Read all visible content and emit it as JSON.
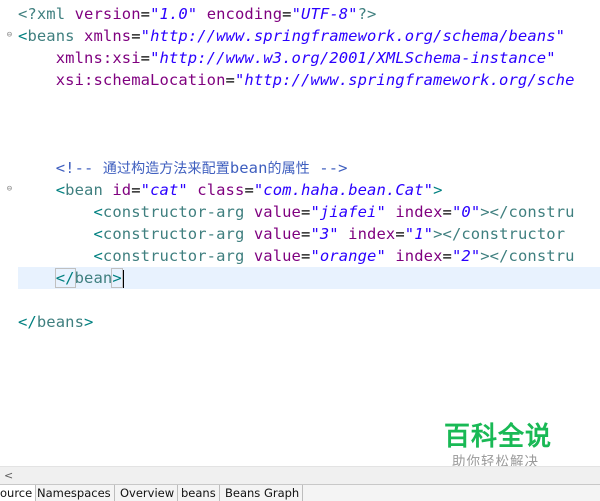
{
  "editor": {
    "line1": {
      "pi_open": "<?xml",
      "a1": "version",
      "eq": "=",
      "v1": "\"1.0\"",
      "a2": "encoding",
      "v2": "\"UTF-8\"",
      "pi_close": "?>"
    },
    "line2": {
      "open": "<",
      "tag": "beans",
      "a1": "xmlns",
      "eq": "=",
      "v1": "\"http://www.springframework.org/schema/beans\""
    },
    "line3": {
      "a1": "xmlns:xsi",
      "eq": "=",
      "v1": "\"http://www.w3.org/2001/XMLSchema-instance\""
    },
    "line4": {
      "a1": "xsi:schemaLocation",
      "eq": "=",
      "v1": "\"http://www.springframework.org/sche"
    },
    "comment": {
      "open": "<!--",
      "text_cjk": "通过构造方法来配置",
      "text_bean": "bean",
      "text_cjk2": "的属性",
      "close": "-->"
    },
    "bean": {
      "open": "<",
      "tag": "bean",
      "a1": "id",
      "eq": "=",
      "v1": "\"cat\"",
      "a2": "class",
      "v2": "\"com.haha.bean.Cat\"",
      "close": ">"
    },
    "args": [
      {
        "open": "<",
        "tag": "constructor-arg",
        "a1": "value",
        "eq": "=",
        "v1": "\"jiafei\"",
        "a2": "index",
        "v2": "\"0\"",
        "tail": "></constru"
      },
      {
        "open": "<",
        "tag": "constructor-arg",
        "a1": "value",
        "eq": "=",
        "v1": "\"3\"",
        "a2": "index",
        "v2": "\"1\"",
        "tail": "></constructor"
      },
      {
        "open": "<",
        "tag": "constructor-arg",
        "a1": "value",
        "eq": "=",
        "v1": "\"orange\"",
        "a2": "index",
        "v2": "\"2\"",
        "tail": "></constru"
      }
    ],
    "bean_close": {
      "open": "</",
      "tag": "bean",
      "close": ">"
    },
    "beans_close": {
      "open": "</",
      "tag": "beans",
      "close": ">"
    }
  },
  "scrollbar": {
    "left_arrow": "<"
  },
  "tabs": [
    "ource",
    "Namespaces",
    "Overview",
    "beans",
    "Beans Graph"
  ],
  "watermark": {
    "logo": "百科全说",
    "subtitle": "助你轻松解决"
  },
  "colors": {
    "tag": "#3f7f7f",
    "attribute": "#7f007f",
    "value": "#2a00ff",
    "comment": "#3f5fbf",
    "current_line": "#e8f2fe",
    "watermark_green": "#19b955"
  }
}
